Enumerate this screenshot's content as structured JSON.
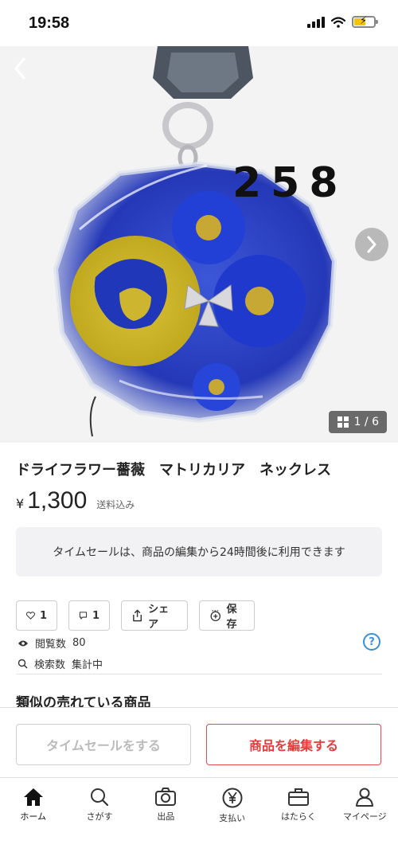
{
  "status_bar": {
    "time": "19:58"
  },
  "hero": {
    "photo_number": "258",
    "counter": "1 / 6"
  },
  "product": {
    "title": "ドライフラワー薔薇　マトリカリア　ネックレス",
    "currency": "¥",
    "price": "1,300",
    "shipping": "送料込み"
  },
  "notice": "タイムセールは、商品の編集から24時間後に利用できます",
  "actions": {
    "like_count": "1",
    "comment_count": "1",
    "share_label": "シェア",
    "save_label": "保存"
  },
  "stats": {
    "views_label": "閲覧数",
    "views_value": "80",
    "search_label": "検索数",
    "search_value": "集計中"
  },
  "similar_heading": "類似の売れている商品",
  "action_bar": {
    "timesale_label": "タイムセールをする",
    "edit_label": "商品を編集する"
  },
  "tabs": [
    {
      "label": "ホーム",
      "icon": "home-icon"
    },
    {
      "label": "さがす",
      "icon": "search-icon"
    },
    {
      "label": "出品",
      "icon": "camera-icon"
    },
    {
      "label": "支払い",
      "icon": "yen-icon"
    },
    {
      "label": "はたらく",
      "icon": "briefcase-icon"
    },
    {
      "label": "マイページ",
      "icon": "person-icon"
    }
  ],
  "colors": {
    "accent_red": "#e43c3c",
    "help_blue": "#3b8ed8"
  }
}
